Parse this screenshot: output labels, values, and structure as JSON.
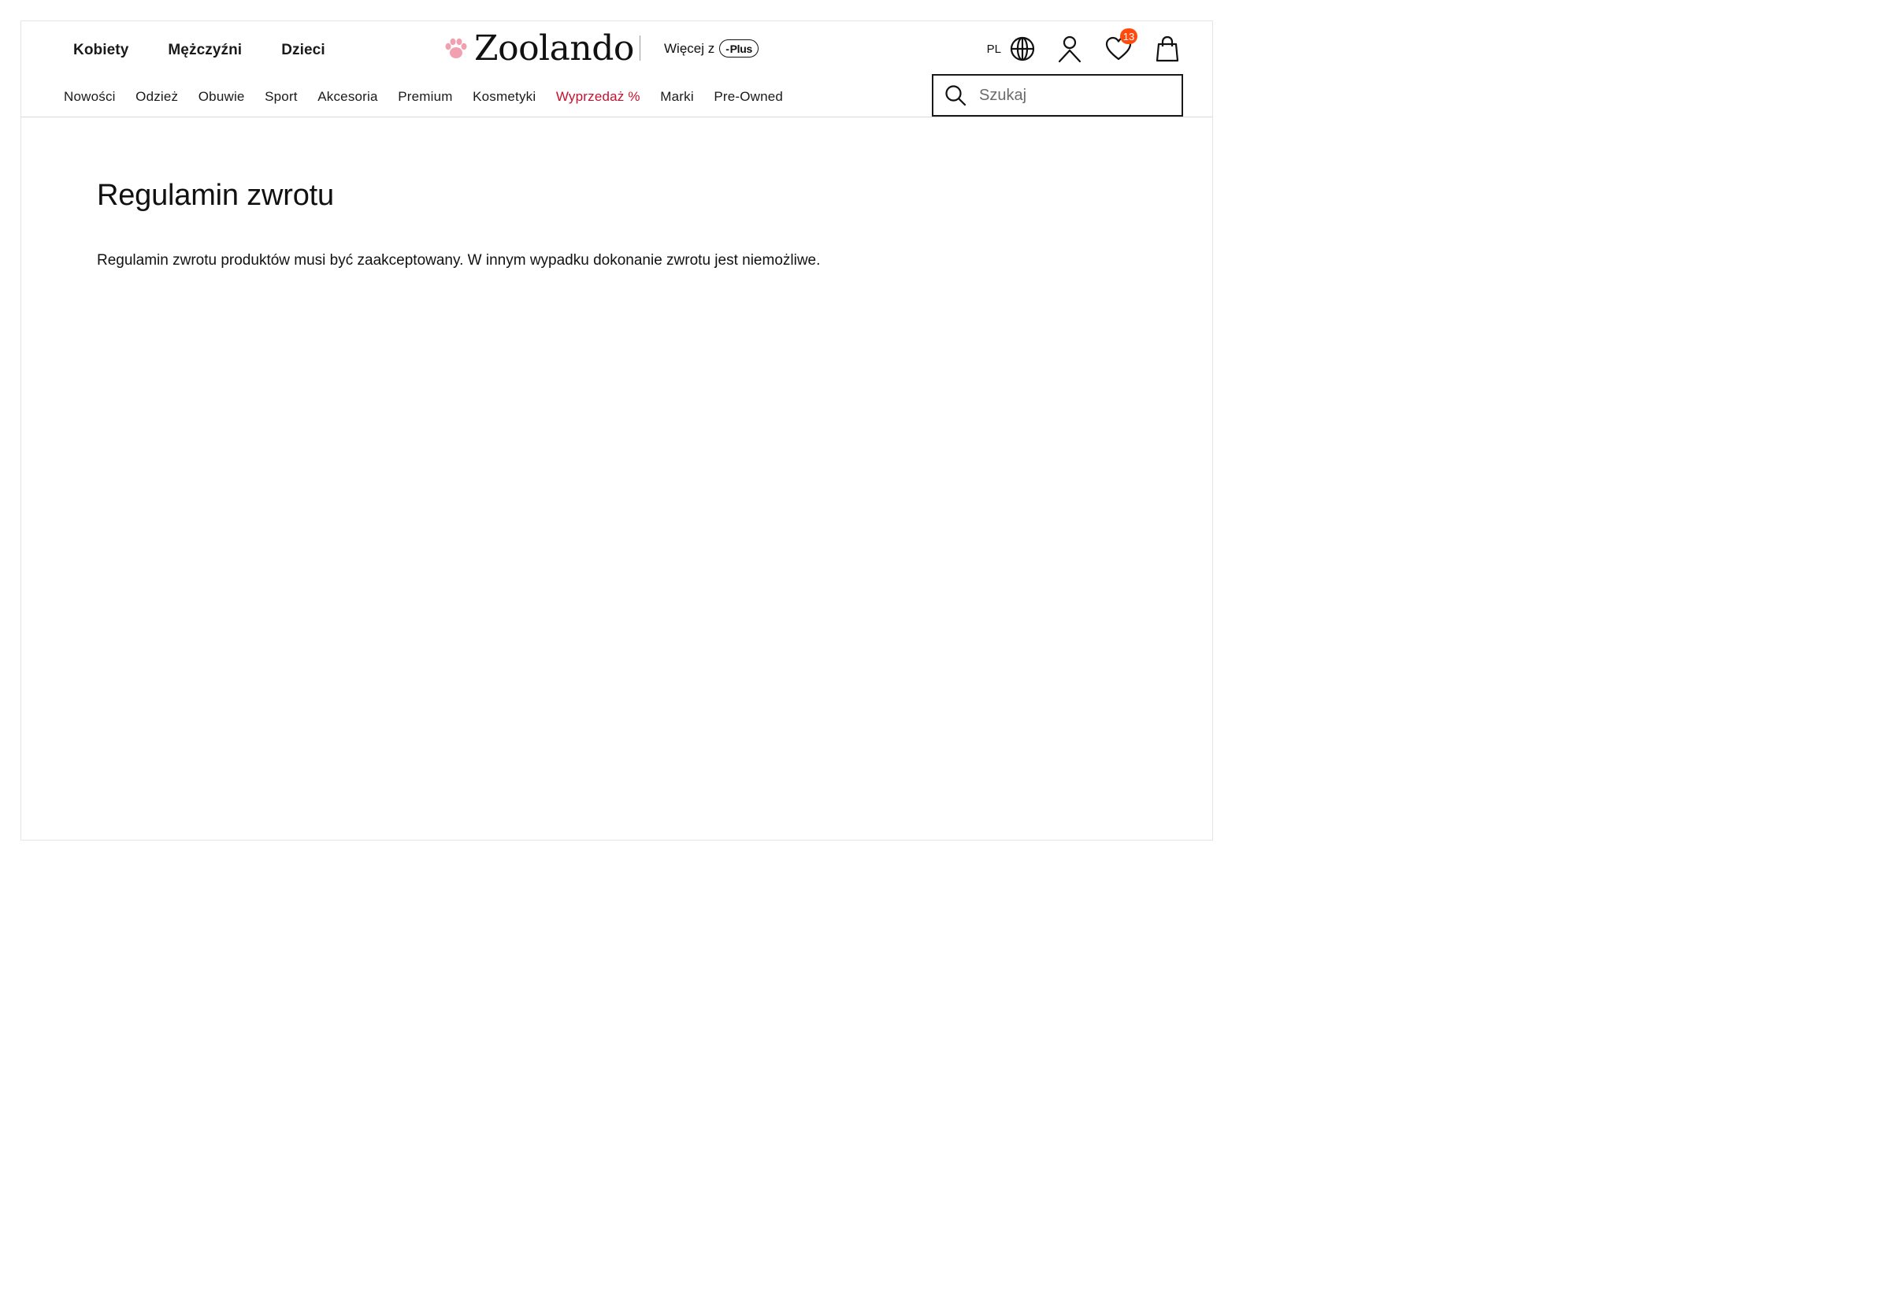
{
  "gender_nav": [
    "Kobiety",
    "Mężczyźni",
    "Dzieci"
  ],
  "logo": {
    "text": "Zoolando",
    "icon": "paw-icon",
    "color": "#f2a0b0"
  },
  "more_from": {
    "label": "Więcej z",
    "badge_prefix": "-",
    "badge": "Plus"
  },
  "utility": {
    "language": "PL",
    "wishlist_count": "13",
    "badge_color": "#ff4a0e",
    "icons": [
      "globe-icon",
      "user-icon",
      "heart-icon",
      "bag-icon"
    ]
  },
  "category_nav": [
    {
      "label": "Nowości"
    },
    {
      "label": "Odzież"
    },
    {
      "label": "Obuwie"
    },
    {
      "label": "Sport"
    },
    {
      "label": "Akcesoria"
    },
    {
      "label": "Premium"
    },
    {
      "label": "Kosmetyki"
    },
    {
      "label": "Wyprzedaż %",
      "color": "#c8102e"
    },
    {
      "label": "Marki"
    },
    {
      "label": "Pre-Owned"
    }
  ],
  "search": {
    "placeholder": "Szukaj",
    "value": ""
  },
  "page": {
    "title": "Regulamin zwrotu",
    "text": "Regulamin zwrotu produktów musi być zaakceptowany. W innym wypadku dokonanie zwrotu jest niemożliwe."
  }
}
